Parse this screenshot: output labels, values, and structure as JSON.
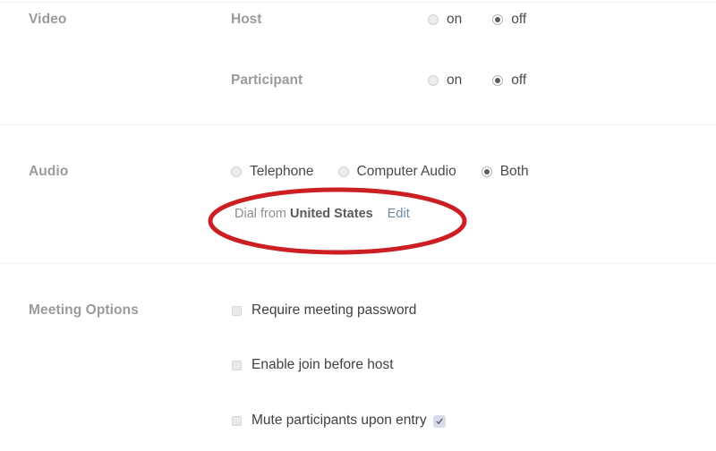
{
  "page": {
    "background": "#ffffff",
    "label_color": "#9b9b9f",
    "text_color": "#404045",
    "link_color": "#6d8aa6",
    "annotation_color": "#cc1f24"
  },
  "sections": {
    "video": {
      "label": "Video",
      "fields": [
        {
          "label": "Host",
          "options": [
            {
              "label": "on",
              "selected": false
            },
            {
              "label": "off",
              "selected": true
            }
          ]
        },
        {
          "label": "Participant",
          "options": [
            {
              "label": "on",
              "selected": false
            },
            {
              "label": "off",
              "selected": true
            }
          ]
        }
      ]
    },
    "audio": {
      "label": "Audio",
      "options": [
        {
          "label": "Telephone",
          "selected": false
        },
        {
          "label": "Computer Audio",
          "selected": false
        },
        {
          "label": "Both",
          "selected": true
        }
      ],
      "dial": {
        "prefix": "Dial from",
        "country": "United States",
        "edit_label": "Edit"
      }
    },
    "meeting_options": {
      "label": "Meeting Options",
      "items": [
        {
          "label": "Require meeting password",
          "checked": false,
          "badge": null
        },
        {
          "label": "Enable join before host",
          "checked": false,
          "badge": null
        },
        {
          "label": "Mute participants upon entry",
          "checked": false,
          "badge": "info-check-badge-icon"
        }
      ]
    }
  },
  "annotation": {
    "shape": "ellipse",
    "name": "red-ellipse-highlight",
    "color": "#cc1f24",
    "target": "Dial from United States Edit"
  }
}
